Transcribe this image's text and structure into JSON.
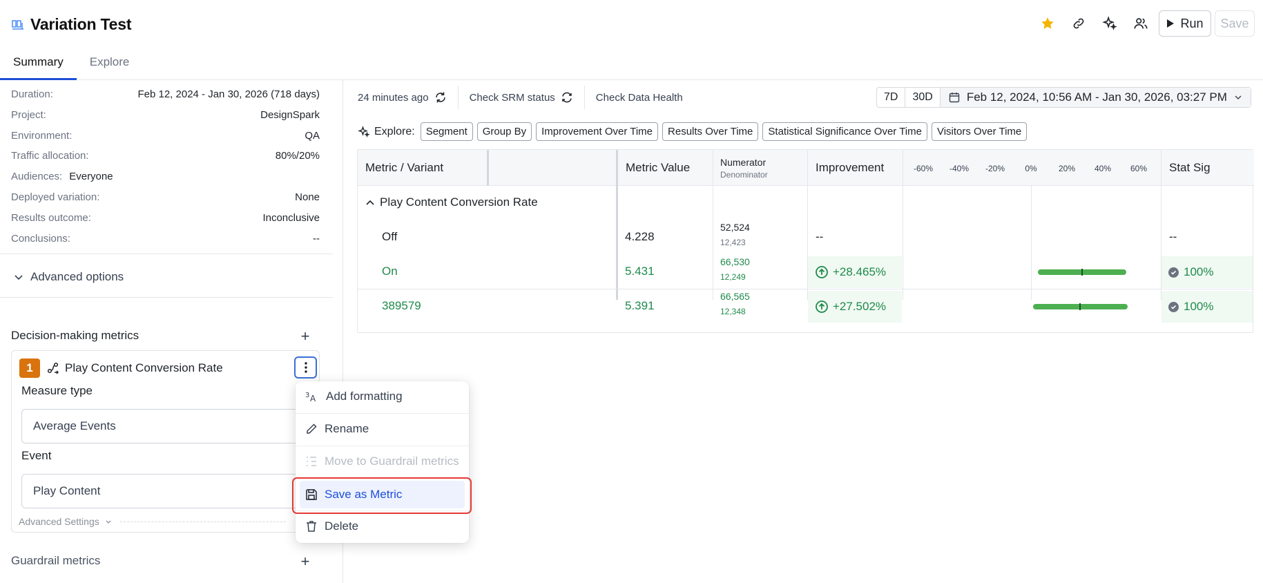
{
  "header": {
    "title": "Variation Test",
    "tabs": [
      {
        "label": "Summary",
        "active": true
      },
      {
        "label": "Explore",
        "active": false
      }
    ],
    "actions": {
      "run_label": "Run",
      "save_label": "Save"
    },
    "icons": [
      "star-icon",
      "link-icon",
      "sparkle-icon",
      "users-icon"
    ],
    "star_color": "#f5b400"
  },
  "details": [
    {
      "key": "Duration:",
      "value": "Feb 12, 2024 - Jan 30, 2026 (718 days)"
    },
    {
      "key": "Project:",
      "value": "DesignSpark"
    },
    {
      "key": "Environment:",
      "value": "QA"
    },
    {
      "key": "Traffic allocation:",
      "value": "80%/20%"
    },
    {
      "key": "Audiences:",
      "value": "Everyone"
    },
    {
      "key": "Deployed variation:",
      "value": "None"
    },
    {
      "key": "Results outcome:",
      "value": "Inconclusive"
    },
    {
      "key": "Conclusions:",
      "value": "--"
    }
  ],
  "advanced_options_label": "Advanced options",
  "decision_metrics": {
    "title": "Decision-making metrics",
    "metric": {
      "index": "1",
      "name": "Play Content Conversion Rate",
      "measure_type_label": "Measure type",
      "measure_type_value": "Average Events",
      "event_label": "Event",
      "event_value": "Play Content",
      "advanced_settings_label": "Advanced Settings"
    }
  },
  "guardrail_title": "Guardrail metrics",
  "context_menu": {
    "items": [
      {
        "label": "Add formatting",
        "icon": "text-format-icon",
        "state": "normal"
      },
      {
        "label": "Rename",
        "icon": "pencil-icon",
        "state": "normal"
      },
      {
        "label": "Move to Guardrail metrics",
        "icon": "list-indent-icon",
        "state": "disabled"
      },
      {
        "label": "Save as Metric",
        "icon": "floppy-disk-icon",
        "state": "highlighted"
      },
      {
        "label": "Delete",
        "icon": "trash-icon",
        "state": "normal"
      }
    ]
  },
  "toolbar": {
    "updated": "24 minutes ago",
    "srm": "Check SRM status",
    "health": "Check Data Health",
    "range_7d": "7D",
    "range_30d": "30D",
    "date_range": "Feb 12, 2024, 10:56 AM - Jan 30, 2026, 03:27 PM"
  },
  "explore": {
    "label": "Explore:",
    "chips": [
      "Segment",
      "Group By",
      "Improvement Over Time",
      "Results Over Time",
      "Statistical Significance Over Time",
      "Visitors Over Time"
    ]
  },
  "results_table": {
    "headers": {
      "metric_variant": "Metric / Variant",
      "metric_value": "Metric Value",
      "numerator": "Numerator",
      "denominator": "Denominator",
      "improvement": "Improvement",
      "stat_sig": "Stat Sig"
    },
    "ci_ticks": [
      "-60%",
      "-40%",
      "-20%",
      "0%",
      "20%",
      "40%",
      "60%"
    ],
    "group_name": "Play Content Conversion Rate",
    "rows": [
      {
        "variant": "Off",
        "metric_value": "4.228",
        "numerator": "52,524",
        "denominator": "12,423",
        "improvement": "--",
        "stat_sig": "--"
      },
      {
        "variant": "On",
        "metric_value": "5.431",
        "numerator": "66,530",
        "denominator": "12,249",
        "improvement": "+28.465%",
        "stat_sig": "100%",
        "ci_low": 4,
        "ci_high": 53
      },
      {
        "variant": "389579",
        "metric_value": "5.391",
        "numerator": "66,565",
        "denominator": "12,348",
        "improvement": "+27.502%",
        "stat_sig": "100%",
        "ci_low": 1,
        "ci_high": 54
      }
    ],
    "positive_color": "#1f8a4c"
  }
}
